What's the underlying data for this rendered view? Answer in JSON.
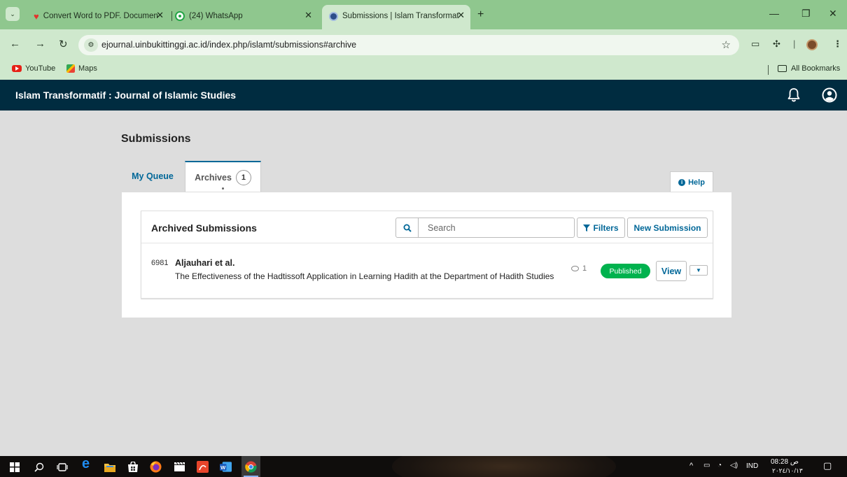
{
  "browser": {
    "tabs": [
      {
        "title": "Convert Word to PDF. Documen",
        "active": false
      },
      {
        "title": "(24) WhatsApp",
        "active": false,
        "badge": "24"
      },
      {
        "title": "Submissions | Islam Transformat",
        "active": true
      }
    ],
    "url": "ejournal.uinbukittinggi.ac.id/index.php/islamt/submissions#archive",
    "bookmarks": [
      "YouTube",
      "Maps"
    ],
    "all_bookmarks_label": "All Bookmarks"
  },
  "site": {
    "title": "Islam Transformatif : Journal of Islamic Studies"
  },
  "page": {
    "heading": "Submissions",
    "tabs": {
      "my_queue": "My Queue",
      "archives": "Archives",
      "archives_count": "1"
    },
    "help_label": "Help"
  },
  "list": {
    "title": "Archived Submissions",
    "search_placeholder": "Search",
    "filters_label": "Filters",
    "new_submission_label": "New Submission",
    "items": [
      {
        "id": "6981",
        "author": "Aljauhari et al.",
        "title": "The Effectiveness of the Hadtissoft Application in Learning Hadith at the Department of Hadith Studies",
        "comments": "1",
        "status": "Published",
        "view_label": "View"
      }
    ]
  },
  "taskbar": {
    "language": "IND",
    "time": "08:28 ص",
    "date": "٢٠٢٤/١٠/١٣"
  },
  "colors": {
    "header": "#002c40",
    "primary": "#006798",
    "published": "#00b24e",
    "chrome_frame": "#8fc78e",
    "chrome_toolbar": "#cfe8cd"
  }
}
